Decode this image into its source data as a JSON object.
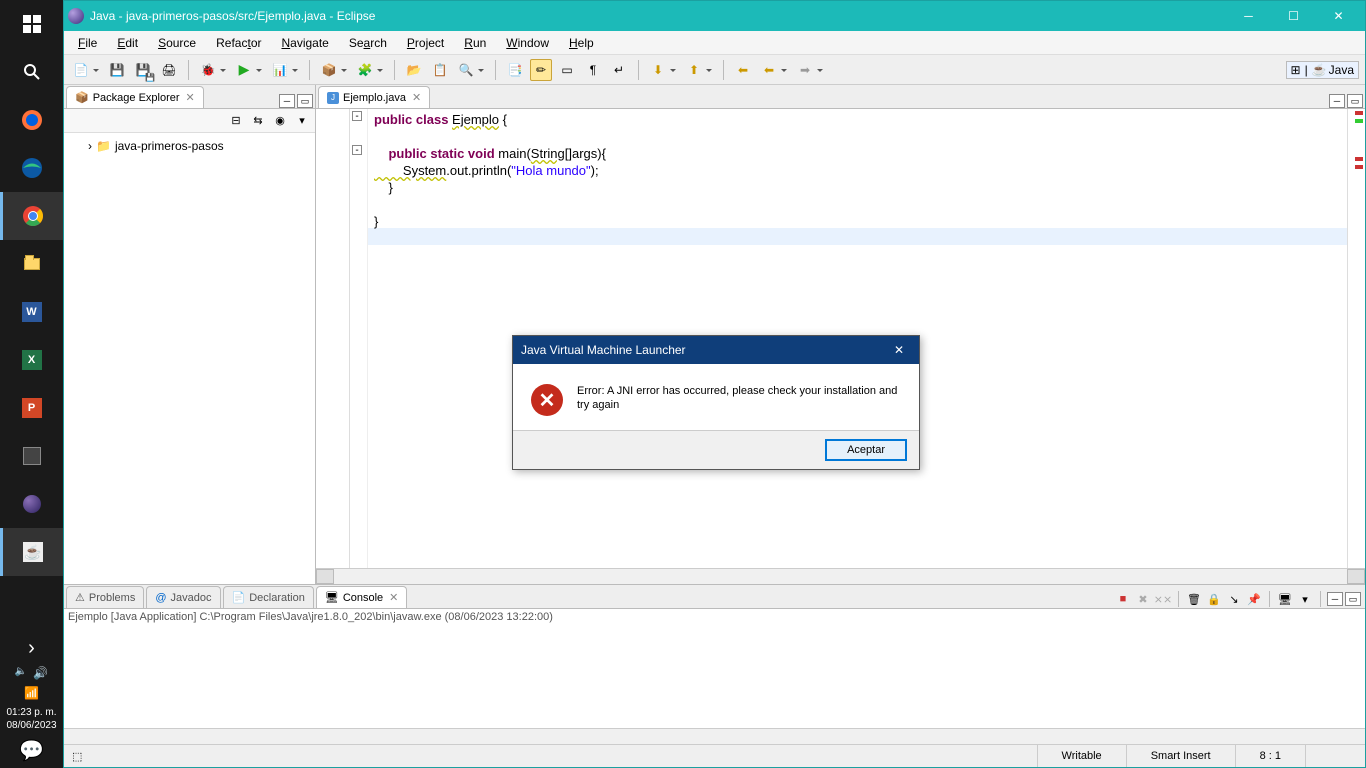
{
  "titlebar": {
    "title": "Java - java-primeros-pasos/src/Ejemplo.java - Eclipse"
  },
  "menus": [
    "File",
    "Edit",
    "Source",
    "Refactor",
    "Navigate",
    "Search",
    "Project",
    "Run",
    "Window",
    "Help"
  ],
  "perspective": "Java",
  "package_explorer": {
    "title": "Package Explorer",
    "project": "java-primeros-pasos"
  },
  "editor": {
    "tab": "Ejemplo.java",
    "code": {
      "l1a": "public",
      "l1b": " class ",
      "l1c": "Ejemplo",
      "l1d": " {",
      "l3a": "    public",
      "l3b": " static",
      "l3c": " void",
      "l3d": " main(",
      "l3e": "String",
      "l3f": "[]args){",
      "l4a": "        System",
      "l4b": ".out.println(",
      "l4c": "\"Hola mundo\"",
      "l4d": ");",
      "l5": "    }",
      "l7": "}"
    }
  },
  "bottom": {
    "tabs": [
      "Problems",
      "Javadoc",
      "Declaration",
      "Console"
    ],
    "active": "Console",
    "console_header": "Ejemplo [Java Application] C:\\Program Files\\Java\\jre1.8.0_202\\bin\\javaw.exe (08/06/2023 13:22:00)"
  },
  "status": {
    "writable": "Writable",
    "insert": "Smart Insert",
    "pos": "8 : 1"
  },
  "dialog": {
    "title": "Java Virtual Machine Launcher",
    "message": "Error: A JNI error has occurred, please check your installation and try again",
    "ok": "Aceptar"
  },
  "taskbar": {
    "time": "01:23 p. m.",
    "date": "08/06/2023"
  }
}
